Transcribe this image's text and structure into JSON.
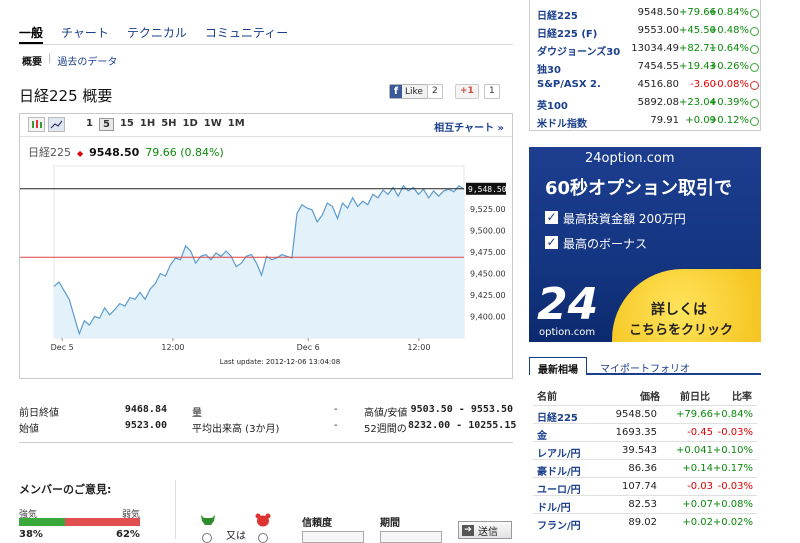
{
  "tabs": [
    {
      "label": "一般",
      "active": true
    },
    {
      "label": "チャート",
      "active": false
    },
    {
      "label": "テクニカル",
      "active": false
    },
    {
      "label": "コミュニティー",
      "active": false
    }
  ],
  "subtabs": [
    "概要",
    "過去のデータ"
  ],
  "page_title": "日経225 概要",
  "social": {
    "like": "Like",
    "like_count": "2",
    "gplus": "+1",
    "gplus_count": "1"
  },
  "chart_toolbar": {
    "timeframes": [
      "1",
      "5",
      "15",
      "1H",
      "5H",
      "1D",
      "1W",
      "1M"
    ],
    "active_timeframe": "5",
    "compare_link": "相互チャート »"
  },
  "quote": {
    "name": "日経225",
    "price": "9548.50",
    "change": "79.66 (0.84%)"
  },
  "chart_data": {
    "type": "line",
    "ylim": [
      9375,
      9575
    ],
    "yticks": [
      "9,525.00",
      "9,500.00",
      "9,475.00",
      "9,450.00",
      "9,425.00",
      "9,400.00"
    ],
    "xticks": [
      "Dec 5",
      "12:00",
      "Dec 6",
      "12:00"
    ],
    "last_price_label": "9,548.50",
    "prev_close": 9468.84,
    "last_update": "Last update: 2012-12-06 13:04:08",
    "values": [
      9435,
      9440,
      9430,
      9420,
      9400,
      9380,
      9395,
      9390,
      9400,
      9398,
      9410,
      9402,
      9408,
      9415,
      9412,
      9422,
      9420,
      9428,
      9420,
      9432,
      9438,
      9450,
      9447,
      9460,
      9468,
      9466,
      9482,
      9476,
      9462,
      9470,
      9472,
      9466,
      9474,
      9470,
      9476,
      9470,
      9458,
      9462,
      9470,
      9472,
      9462,
      9448,
      9470,
      9466,
      9468,
      9472,
      9470,
      9468,
      9520,
      9530,
      9526,
      9524,
      9510,
      9518,
      9532,
      9528,
      9514,
      9532,
      9526,
      9538,
      9528,
      9534,
      9530,
      9542,
      9538,
      9547,
      9542,
      9550,
      9540,
      9552,
      9546,
      9550,
      9542,
      9548,
      9538,
      9546,
      9540,
      9546,
      9548,
      9545,
      9552,
      9548
    ]
  },
  "stats": [
    {
      "label": "前日終値",
      "value": "9468.84"
    },
    {
      "label": "始値",
      "value": "9523.00"
    },
    {
      "label": "量",
      "value": "-"
    },
    {
      "label": "平均出来高 (3か月)",
      "value": "-"
    },
    {
      "label": "高値/安値",
      "value": "9503.50 - 9553.50"
    },
    {
      "label": "52週間の",
      "value": "8232.00 - 10255.15"
    }
  ],
  "opinion": {
    "title": "メンバーのご意見:",
    "bull_label": "強気",
    "bear_label": "弱気",
    "bull_pct": "38%",
    "bear_pct": "62%",
    "bull_value": 0.38,
    "or_label": "又は",
    "confidence_label": "信頼度",
    "period_label": "期間",
    "submit_label": "送信"
  },
  "top_markets": [
    {
      "name": "日経225",
      "value": "9548.50",
      "change": "+79.66",
      "pct": "+0.84%",
      "dir": "up"
    },
    {
      "name": "日経225 (F)",
      "value": "9553.00",
      "change": "+45.50",
      "pct": "+0.48%",
      "dir": "up"
    },
    {
      "name": "ダウジョーンズ30",
      "value": "13034.49",
      "change": "+82.71",
      "pct": "+0.64%",
      "dir": "up"
    },
    {
      "name": "独30",
      "value": "7454.55",
      "change": "+19.43",
      "pct": "+0.26%",
      "dir": "up"
    },
    {
      "name": "S&P/ASX 2.",
      "value": "4516.80",
      "change": "-3.60",
      "pct": "-0.08%",
      "dir": "down"
    },
    {
      "name": "英100",
      "value": "5892.08",
      "change": "+23.04",
      "pct": "+0.39%",
      "dir": "up"
    },
    {
      "name": "米ドル指数",
      "value": "79.91",
      "change": "+0.09",
      "pct": "+0.12%",
      "dir": "up"
    }
  ],
  "ad": {
    "brand": "24option.com",
    "headline": "60秒オプション取引で",
    "line1": "最高投資金額 200万円",
    "line2": "最高のボーナス",
    "logo_num": "24",
    "logo_sub": "option.com",
    "cta1": "詳しくは",
    "cta2": "こちらをクリック"
  },
  "rates": {
    "tab_latest": "最新相場",
    "tab_portfolio": "マイポートフォリオ",
    "headers": [
      "名前",
      "価格",
      "前日比",
      "比率"
    ],
    "rows": [
      {
        "name": "日経225",
        "value": "9548.50",
        "change": "+79.66",
        "pct": "+0.84%",
        "dir": "up"
      },
      {
        "name": "金",
        "value": "1693.35",
        "change": "-0.45",
        "pct": "-0.03%",
        "dir": "down"
      },
      {
        "name": "レアル/円",
        "value": "39.543",
        "change": "+0.041",
        "pct": "+0.10%",
        "dir": "up"
      },
      {
        "name": "豪ドル/円",
        "value": "86.36",
        "change": "+0.14",
        "pct": "+0.17%",
        "dir": "up"
      },
      {
        "name": "ユーロ/円",
        "value": "107.74",
        "change": "-0.03",
        "pct": "-0.03%",
        "dir": "down"
      },
      {
        "name": "ドル/円",
        "value": "82.53",
        "change": "+0.07",
        "pct": "+0.08%",
        "dir": "up"
      },
      {
        "name": "フラン/円",
        "value": "89.02",
        "change": "+0.02",
        "pct": "+0.02%",
        "dir": "up"
      }
    ]
  },
  "colors": {
    "up": "#0a8a0a",
    "down": "#d00",
    "link": "#1a3f8c",
    "chart_fill": "#e3f1fb",
    "chart_line": "#5a9bd0"
  }
}
